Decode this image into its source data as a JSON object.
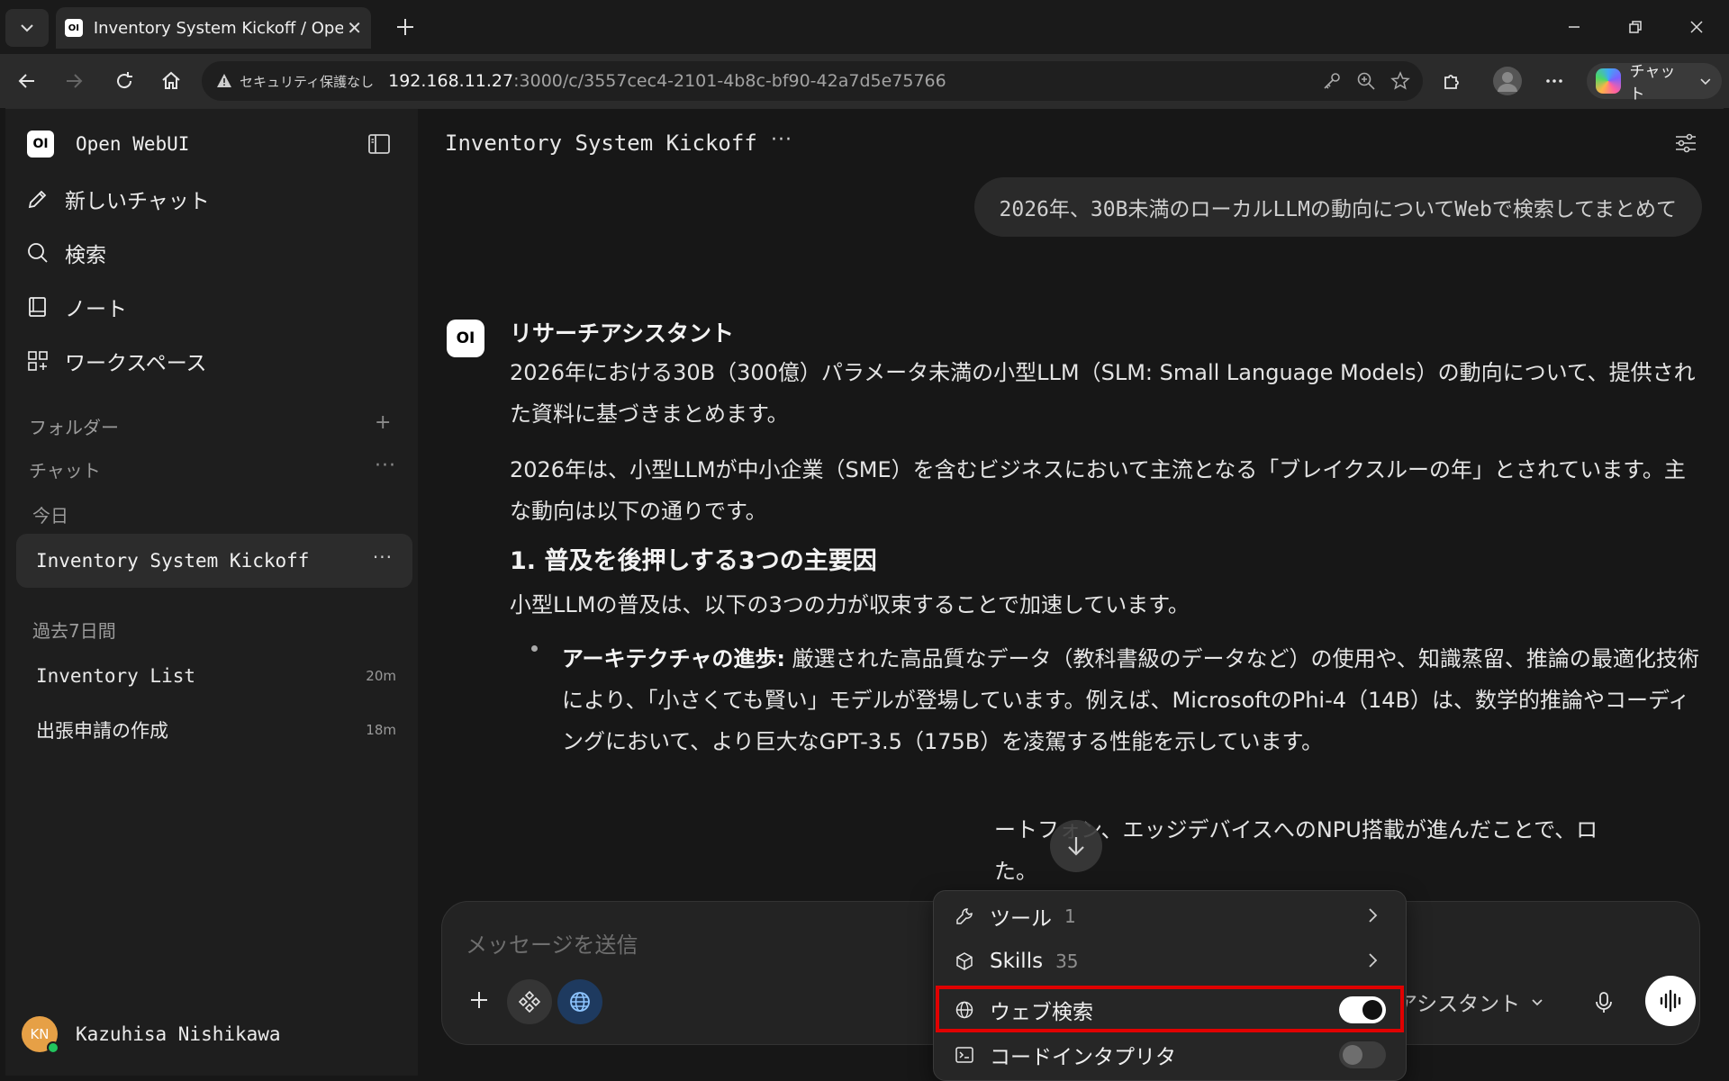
{
  "browser": {
    "tab_title": "Inventory System Kickoff / Open WebUI",
    "security_label": "セキュリティ保護なし",
    "url_host": "192.168.11.27",
    "url_path": ":3000/c/3557cec4-2101-4b8c-bf90-42a7d5e75766",
    "copilot_label": "チャット"
  },
  "sidebar": {
    "brand_logo": "OI",
    "brand_name": "Open WebUI",
    "nav": {
      "new_chat": "新しいチャット",
      "search": "検索",
      "notes": "ノート",
      "workspace": "ワークスペース"
    },
    "folders_label": "フォルダー",
    "chats_label": "チャット",
    "today_label": "今日",
    "active_chat": "Inventory System Kickoff",
    "past7_label": "過去7日間",
    "chats": [
      {
        "title": "Inventory List",
        "age": "20m"
      },
      {
        "title": "出張申請の作成",
        "age": "18m"
      }
    ],
    "user": {
      "initials": "KN",
      "name": "Kazuhisa Nishikawa"
    }
  },
  "main": {
    "chat_title": "Inventory System Kickoff",
    "user_message": "2026年、30B未満のローカルLLMの動向についてWebで検索してまとめて",
    "assistant": {
      "avatar": "OI",
      "name": "リサーチアシスタント",
      "para1": "2026年における30B（300億）パラメータ未満の小型LLM（SLM: Small Language Models）の動向について、提供された資料に基づきまとめます。",
      "para2": "2026年は、小型LLMが中小企業（SME）を含むビジネスにおいて主流となる「ブレイクスルーの年」とされています。主な動向は以下の通りです。",
      "heading1": "1.  普及を後押しする3つの主要因",
      "para3": "小型LLMの普及は、以下の3つの力が収束することで加速しています。",
      "bullet1_bold": "アーキテクチャの進歩:",
      "bullet1_text": " 厳選された高品質なデータ（教科書級のデータなど）の使用や、知識蒸留、推論の最適化技術により、「小さくても賢い」モデルが登場しています。例えば、MicrosoftのPhi-4（14B）は、数学的推論やコーディングにおいて、より巨大なGPT-3.5（175B）を凌駕する性能を示しています。",
      "bullet2_text_a": "ートフォン、エッジデバイスへのNPU搭載が進んだことで、ロ",
      "bullet2_text_b": "た。"
    },
    "composer": {
      "placeholder": "メッセージを送信",
      "model": "リサーチアシスタント"
    }
  },
  "menu": {
    "tools_label": "ツール",
    "tools_count": "1",
    "skills_label": "Skills",
    "skills_count": "35",
    "web_search_label": "ウェブ検索",
    "web_search_on": true,
    "code_interpreter_label": "コードインタプリタ",
    "code_interpreter_on": false
  },
  "colors": {
    "highlight": "#e00000",
    "avatar": "#e6a046",
    "online": "#22c55e"
  }
}
